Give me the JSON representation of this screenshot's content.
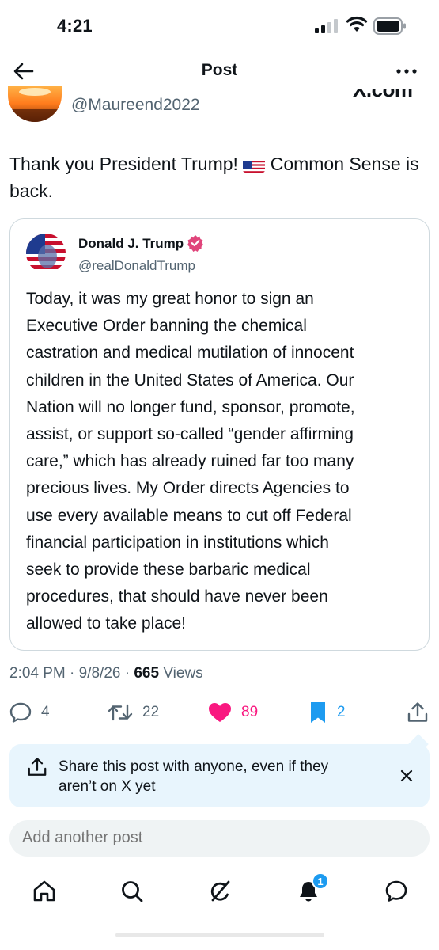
{
  "status_bar": {
    "time": "4:21"
  },
  "header": {
    "title": "Post"
  },
  "post": {
    "handle": "@Maureend2022",
    "logo_text": "X.com",
    "text_before": "Thank you President Trump! ",
    "text_after": " Common Sense is back.",
    "timestamp": "2:04 PM · 9/8/26 · ",
    "views_count": "665",
    "views_label": " Views"
  },
  "quote": {
    "name": "Donald J. Trump",
    "handle": "@realDonaldTrump",
    "lines": [
      "Today, it was my great honor to sign an",
      "Executive Order banning the chemical",
      "castration and medical mutilation of innocent",
      "children in the United States of America. Our",
      "Nation will no longer fund, sponsor, promote,",
      "assist, or support so-called “gender affirming",
      "care,” which has already ruined far too many",
      "precious lives. My Order directs Agencies to",
      "use every available means to cut off Federal",
      "financial participation in institutions which",
      "seek to provide these barbaric medical",
      "procedures, that should have never been",
      "allowed to take place!"
    ]
  },
  "actions": {
    "replies": "4",
    "reposts": "22",
    "likes": "89",
    "bookmarks": "2"
  },
  "share_banner": {
    "line1": "Share this post with anyone, even if they",
    "line2": "aren’t on X yet"
  },
  "compose": {
    "placeholder": "Add another post"
  },
  "tabbar": {
    "notification_badge": "1"
  },
  "colors": {
    "accent": "#1d9bf0",
    "like": "#f91880",
    "secondary_text": "#536471",
    "banner_bg": "#e8f5fd"
  },
  "icons": {
    "back": "arrow-left-icon",
    "more": "more-horizontal-icon",
    "reply": "reply-icon",
    "repost": "repost-icon",
    "like": "heart-icon",
    "bookmark": "bookmark-icon",
    "share": "share-icon",
    "close": "close-icon",
    "home": "home-icon",
    "search": "search-icon",
    "grok": "grok-icon",
    "notifications": "bell-icon",
    "messages": "messages-icon"
  }
}
